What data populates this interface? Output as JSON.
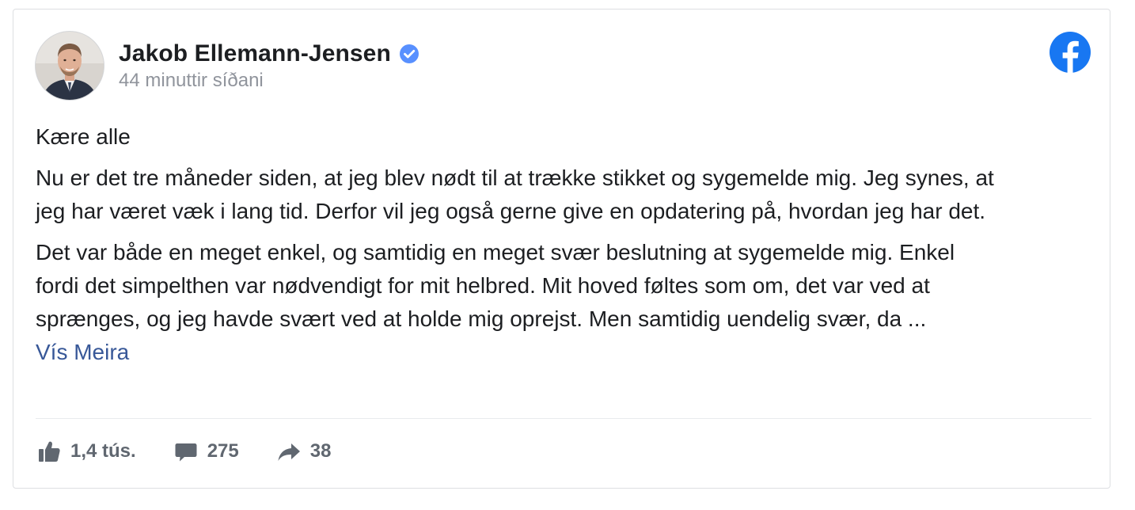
{
  "post": {
    "author": "Jakob Ellemann-Jensen",
    "timestamp": "44 minuttir síðani",
    "paragraphs": [
      "Kære alle",
      "Nu er det tre måneder siden, at jeg blev nødt til at trække stikket og sygemelde mig. Jeg synes, at\njeg har været væk i lang tid. Derfor vil jeg også gerne give en opdatering på, hvordan jeg har det.",
      "Det var både en meget enkel, og samtidig en meget svær beslutning at sygemelde mig. Enkel\nfordi det simpelthen var nødvendigt for mit helbred. Mit hoved føltes som om, det var ved at\nsprænges, og jeg havde svært ved at holde mig oprejst. Men samtidig uendelig svær, da ..."
    ],
    "see_more": "Vís Meira"
  },
  "stats": {
    "likes": "1,4 tús.",
    "comments": "275",
    "shares": "38"
  },
  "colors": {
    "facebook_blue": "#1877f2",
    "verified_blue": "#5890ff",
    "link_blue": "#385898",
    "muted_gray": "#90949c",
    "footer_gray": "#606770"
  },
  "icons": {
    "verified": "verified-badge-icon",
    "platform": "facebook-logo-icon",
    "like": "thumbs-up-icon",
    "comment": "speech-bubble-icon",
    "share": "share-arrow-icon"
  }
}
